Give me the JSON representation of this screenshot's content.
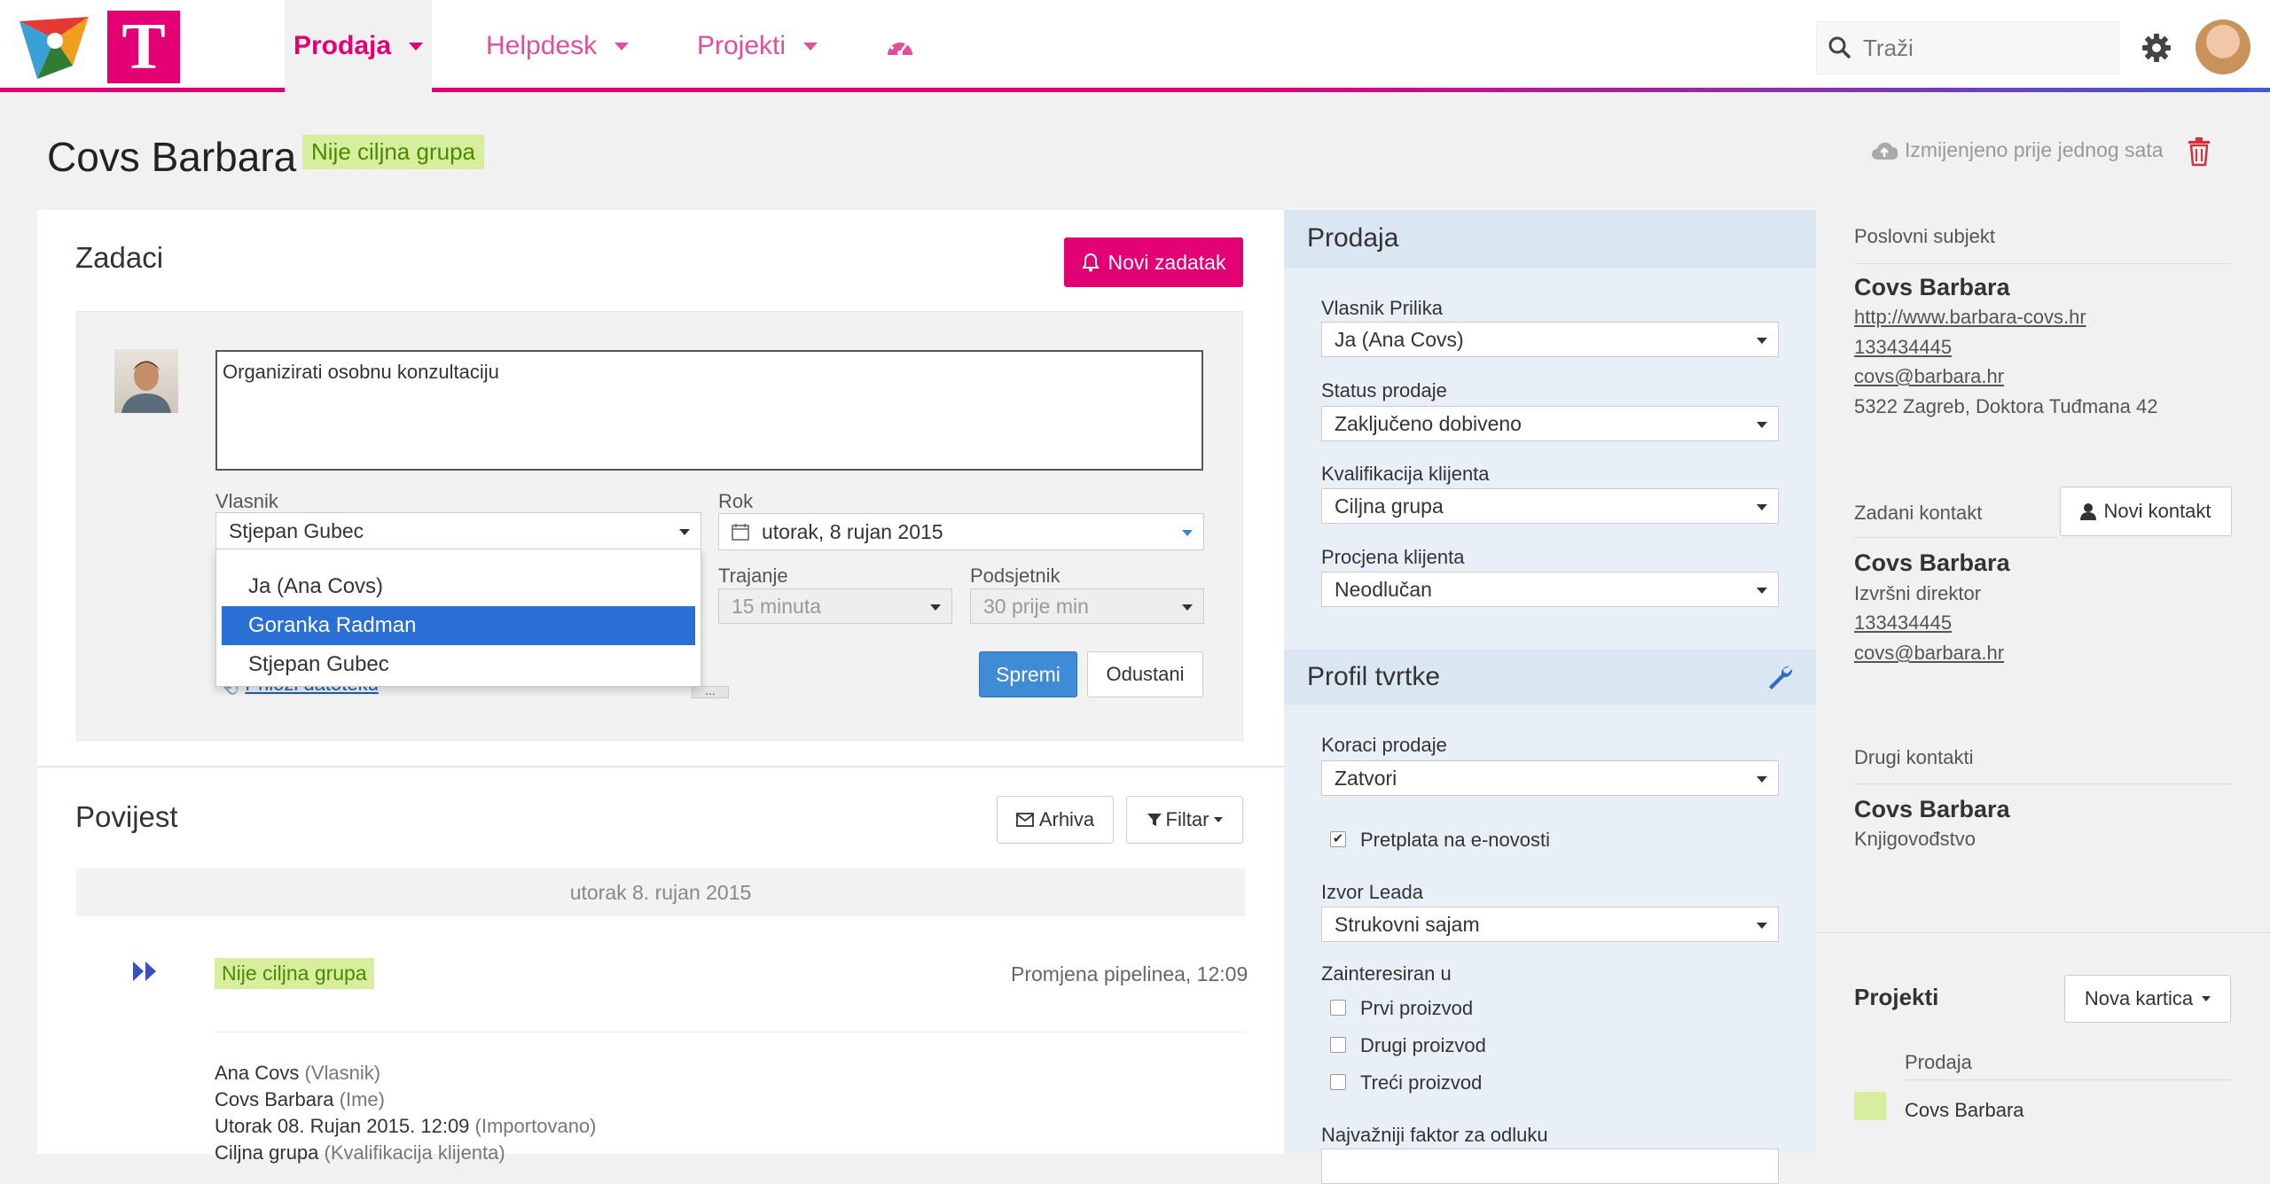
{
  "nav": {
    "items": [
      {
        "label": "Prodaja"
      },
      {
        "label": "Helpdesk"
      },
      {
        "label": "Projekti"
      }
    ],
    "search_placeholder": "Traži"
  },
  "colors": {
    "brand": "#e20074",
    "primary_button": "#3f8bd5",
    "tag_bg": "#d6ee9e",
    "tag_text": "#4b8a00",
    "sidebar_bg": "#e9eff7"
  },
  "header": {
    "title": "Covs Barbara",
    "tag": "Nije ciljna grupa",
    "modified": "Izmijenjeno prije jednog sata"
  },
  "tasks": {
    "title": "Zadaci",
    "new_button": "Novi zadatak",
    "text": "Organizirati osobnu konzultaciju",
    "owner_label": "Vlasnik",
    "owner_value": "Stjepan Gubec",
    "due_label": "Rok",
    "due_value": "utorak, 8 rujan 2015",
    "duration_label": "Trajanje",
    "duration_value": "15 minuta",
    "reminder_label": "Podsjetnik",
    "reminder_value": "30 prije min",
    "attach_label": "Priloži datoteku",
    "attach_dots": "...",
    "save_button": "Spremi",
    "cancel_button": "Odustani",
    "owner_options": [
      "Ja (Ana Covs)",
      "Goranka Radman",
      "Stjepan Gubec"
    ],
    "owner_highlighted": "Goranka Radman"
  },
  "history": {
    "title": "Povijest",
    "archive_button": "Arhiva",
    "filter_button": "Filtar",
    "day": "utorak 8. rujan 2015",
    "entry_tag": "Nije ciljna grupa",
    "entry_meta": "Promjena pipelinea, 12:09",
    "lines": [
      {
        "value": "Ana Covs",
        "field": "(Vlasnik)"
      },
      {
        "value": "Covs Barbara",
        "field": "(Ime)"
      },
      {
        "value": "Utorak 08. Rujan 2015. 12:09",
        "field": "(Importovano)"
      },
      {
        "value": "Ciljna grupa",
        "field": "(Kvalifikacija klijenta)"
      }
    ]
  },
  "sales": {
    "title": "Prodaja",
    "fields": [
      {
        "label": "Vlasnik Prilika",
        "value": "Ja (Ana Covs)"
      },
      {
        "label": "Status prodaje",
        "value": "Zaključeno dobiveno"
      },
      {
        "label": "Kvalifikacija klijenta",
        "value": "Ciljna grupa"
      },
      {
        "label": "Procjena klijenta",
        "value": "Neodlučan"
      }
    ]
  },
  "company_profile": {
    "title": "Profil tvrtke",
    "steps_label": "Koraci prodaje",
    "steps_value": "Zatvori",
    "newsletter_label": "Pretplata na e-novosti",
    "newsletter_checked": true,
    "lead_source_label": "Izvor Leada",
    "lead_source_value": "Strukovni sajam",
    "interested_label": "Zainteresiran u",
    "products": [
      "Prvi proizvod",
      "Drugi proizvod",
      "Treći proizvod"
    ],
    "decision_label": "Najvažniji faktor za odluku"
  },
  "right": {
    "entity_label": "Poslovni subjekt",
    "entity_name": "Covs Barbara",
    "entity_url": "http://www.barbara-covs.hr",
    "entity_phone": "133434445",
    "entity_email": "covs@barbara.hr",
    "entity_address": "5322 Zagreb, Doktora Tuđmana 42",
    "default_contact_label": "Zadani kontakt",
    "new_contact_button": "Novi kontakt",
    "contact_name": "Covs Barbara",
    "contact_role": "Izvršni direktor",
    "contact_phone": "133434445",
    "contact_email": "covs@barbara.hr",
    "other_contacts_label": "Drugi kontakti",
    "other_name": "Covs Barbara",
    "other_role": "Knjigovođstvo",
    "projects_label": "Projekti",
    "new_card_button": "Nova kartica",
    "projects_col": "Prodaja",
    "project_row": "Covs Barbara"
  }
}
